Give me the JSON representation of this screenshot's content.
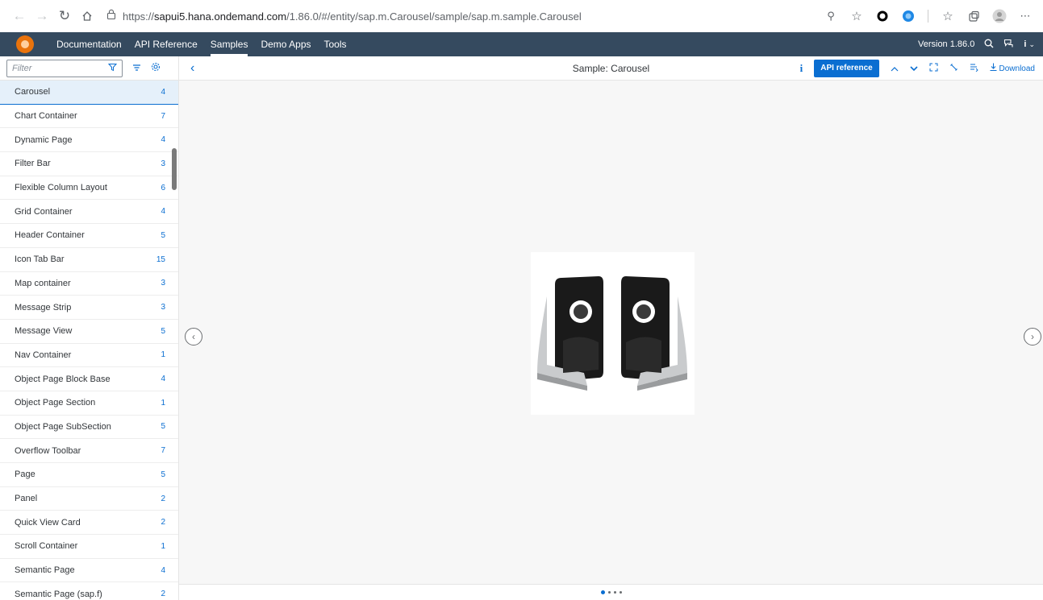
{
  "browser": {
    "url_prefix": "https://",
    "url_host": "sapui5.hana.ondemand.com",
    "url_path": "/1.86.0/#/entity/sap.m.Carousel/sample/sap.m.sample.Carousel"
  },
  "shell": {
    "nav": [
      "Documentation",
      "API Reference",
      "Samples",
      "Demo Apps",
      "Tools"
    ],
    "active_nav": "Samples",
    "version": "Version 1.86.0"
  },
  "sidebar": {
    "filter_placeholder": "Filter",
    "items": [
      {
        "label": "Carousel",
        "count": "4",
        "selected": true
      },
      {
        "label": "Chart Container",
        "count": "7"
      },
      {
        "label": "Dynamic Page",
        "count": "4"
      },
      {
        "label": "Filter Bar",
        "count": "3"
      },
      {
        "label": "Flexible Column Layout",
        "count": "6"
      },
      {
        "label": "Grid Container",
        "count": "4"
      },
      {
        "label": "Header Container",
        "count": "5"
      },
      {
        "label": "Icon Tab Bar",
        "count": "15"
      },
      {
        "label": "Map container",
        "count": "3"
      },
      {
        "label": "Message Strip",
        "count": "3"
      },
      {
        "label": "Message View",
        "count": "5"
      },
      {
        "label": "Nav Container",
        "count": "1"
      },
      {
        "label": "Object Page Block Base",
        "count": "4"
      },
      {
        "label": "Object Page Section",
        "count": "1"
      },
      {
        "label": "Object Page SubSection",
        "count": "5"
      },
      {
        "label": "Overflow Toolbar",
        "count": "7"
      },
      {
        "label": "Page",
        "count": "5"
      },
      {
        "label": "Panel",
        "count": "2"
      },
      {
        "label": "Quick View Card",
        "count": "2"
      },
      {
        "label": "Scroll Container",
        "count": "1"
      },
      {
        "label": "Semantic Page",
        "count": "4"
      },
      {
        "label": "Semantic Page (sap.f)",
        "count": "2"
      }
    ]
  },
  "sample": {
    "title": "Sample: Carousel",
    "api_reference": "API reference",
    "download": "Download",
    "pages": 4,
    "active_page": 0
  },
  "colors": {
    "shell": "#354a5f",
    "accent": "#0a6ed1",
    "selected_row": "#e5f0fa"
  }
}
